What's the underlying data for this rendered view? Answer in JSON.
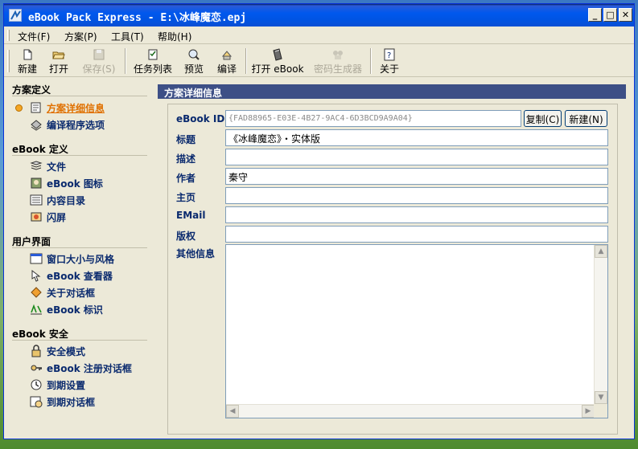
{
  "window": {
    "title": "eBook Pack Express - E:\\冰峰魔恋.epj"
  },
  "menu": [
    {
      "label": "文件(F)"
    },
    {
      "label": "方案(P)"
    },
    {
      "label": "工具(T)"
    },
    {
      "label": "帮助(H)"
    }
  ],
  "toolbar": {
    "new": "新建",
    "open": "打开",
    "save": "保存(S)",
    "tasks": "任务列表",
    "preview": "预览",
    "compile": "编译",
    "open_ebook": "打开 eBook",
    "password_gen": "密码生成器",
    "about": "关于"
  },
  "sidebar": {
    "sections": [
      {
        "title": "方案定义",
        "items": [
          {
            "label": "方案详细信息",
            "icon": "details-icon",
            "active": true
          },
          {
            "label": "编译程序选项",
            "icon": "compiler-options-icon",
            "active": false
          }
        ]
      },
      {
        "title": "eBook 定义",
        "items": [
          {
            "label": "文件",
            "icon": "files-icon"
          },
          {
            "label": "eBook 图标",
            "icon": "ebook-icon-icon"
          },
          {
            "label": "内容目录",
            "icon": "toc-icon"
          },
          {
            "label": "闪屏",
            "icon": "splash-icon"
          }
        ]
      },
      {
        "title": "用户界面",
        "items": [
          {
            "label": "窗口大小与风格",
            "icon": "window-style-icon"
          },
          {
            "label": "eBook 查看器",
            "icon": "viewer-icon"
          },
          {
            "label": "关于对话框",
            "icon": "about-dialog-icon"
          },
          {
            "label": "eBook 标识",
            "icon": "branding-icon"
          }
        ]
      },
      {
        "title": "eBook 安全",
        "items": [
          {
            "label": "安全模式",
            "icon": "lock-icon"
          },
          {
            "label": "eBook 注册对话框",
            "icon": "key-icon"
          },
          {
            "label": "到期设置",
            "icon": "expiry-settings-icon"
          },
          {
            "label": "到期对话框",
            "icon": "expiry-dialog-icon"
          }
        ]
      }
    ]
  },
  "content": {
    "header": "方案详细信息",
    "fields": {
      "ebook_id_label": "eBook ID:",
      "ebook_id_value": "{FAD88965-E03E-4B27-9AC4-6D3BCD9A9A04}",
      "copy_button": "复制(C)",
      "new_button": "新建(N)",
      "title_label": "标题",
      "title_value": "《冰峰魔恋》・实体版",
      "desc_label": "描述",
      "desc_value": "",
      "author_label": "作者",
      "author_value": "秦守",
      "homepage_label": "主页",
      "homepage_value": "",
      "email_label": "EMail",
      "email_value": "",
      "copyright_label": "版权",
      "copyright_value": "",
      "other_label": "其他信息",
      "other_value": ""
    }
  }
}
